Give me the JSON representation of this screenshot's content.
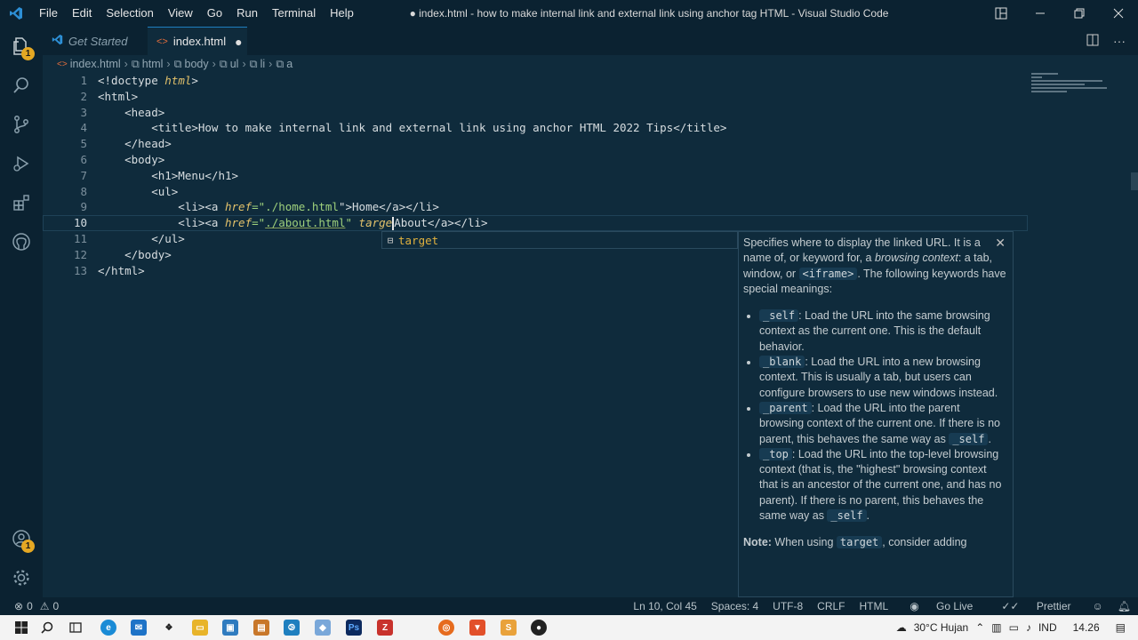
{
  "titlebar": {
    "menu": [
      "File",
      "Edit",
      "Selection",
      "View",
      "Go",
      "Run",
      "Terminal",
      "Help"
    ],
    "window_title": "● index.html - how to make internal link and external link using anchor tag HTML - Visual Studio Code"
  },
  "activity": {
    "explorer_badge": "1",
    "accounts_badge": "1"
  },
  "tabs": [
    {
      "label": "Get Started"
    },
    {
      "label": "index.html"
    }
  ],
  "breadcrumb": [
    "index.html",
    "html",
    "body",
    "ul",
    "li",
    "a"
  ],
  "editor": {
    "line_numbers": [
      "1",
      "2",
      "3",
      "4",
      "5",
      "6",
      "7",
      "8",
      "9",
      "10",
      "11",
      "12",
      "13"
    ],
    "lines": [
      "<!doctype html>",
      "<html>",
      "    <head>",
      "        <title>How to make internal link and external link using anchor HTML 2022 Tips</title>",
      "    </head>",
      "    <body>",
      "        <h1>Menu</h1>",
      "        <ul>",
      "            <li><a href=\"./home.html\">Home</a></li>",
      "            <li><a href=\"./about.html\" target>About</a></li>",
      "        </ul>",
      "    </body>",
      "</html>"
    ],
    "l1_a": "<!doctype ",
    "l1_b": "html",
    "l1_c": ">",
    "l9_a": "            <li><a ",
    "l9_b": "href",
    "l9_c": "=\"",
    "l9_d": "./home.html",
    "l9_e": "\">Home</a></li>",
    "l10_a": "            <li><a ",
    "l10_b": "href",
    "l10_c": "=\"",
    "l10_d": "./about.html",
    "l10_e": "\" ",
    "l10_f": "targe",
    "l10_g": "About</a></li>"
  },
  "suggest": {
    "match": "targe",
    "rest": "t"
  },
  "doc": {
    "intro_a": "Specifies where to display the linked URL. It is a name of, or keyword for, a ",
    "intro_em": "browsing context",
    "intro_b": ": a tab, window, or ",
    "intro_code": "<iframe>",
    "intro_c": ". The following keywords have special meanings:",
    "items": [
      {
        "code": "_self",
        "text": ": Load the URL into the same browsing context as the current one. This is the default behavior.",
        "tail_code": "",
        "tail": ""
      },
      {
        "code": "_blank",
        "text": ": Load the URL into a new browsing context. This is usually a tab, but users can configure browsers to use new windows instead.",
        "tail_code": "",
        "tail": ""
      },
      {
        "code": "_parent",
        "text": ": Load the URL into the parent browsing context of the current one. If there is no parent, this behaves the same way as ",
        "tail_code": "_self",
        "tail": "."
      },
      {
        "code": "_top",
        "text": ": Load the URL into the top-level browsing context (that is, the \"highest\" browsing context that is an ancestor of the current one, and has no parent). If there is no parent, this behaves the same way as ",
        "tail_code": "_self",
        "tail": "."
      }
    ],
    "note_label": "Note:",
    "note_a": " When using ",
    "note_code": "target",
    "note_b": ", consider adding"
  },
  "status": {
    "errors": "0",
    "warnings": "0",
    "position": "Ln 10, Col 45",
    "spaces": "Spaces: 4",
    "encoding": "UTF-8",
    "eol": "CRLF",
    "language": "HTML",
    "golive": "Go Live",
    "prettier": "Prettier"
  },
  "taskbar": {
    "weather": "30°C  Hujan",
    "lang": "IND",
    "time": "14.26"
  },
  "colors": {
    "accent": "#1f7fbf",
    "badge": "#e5a823",
    "background": "#0f2b3c"
  }
}
